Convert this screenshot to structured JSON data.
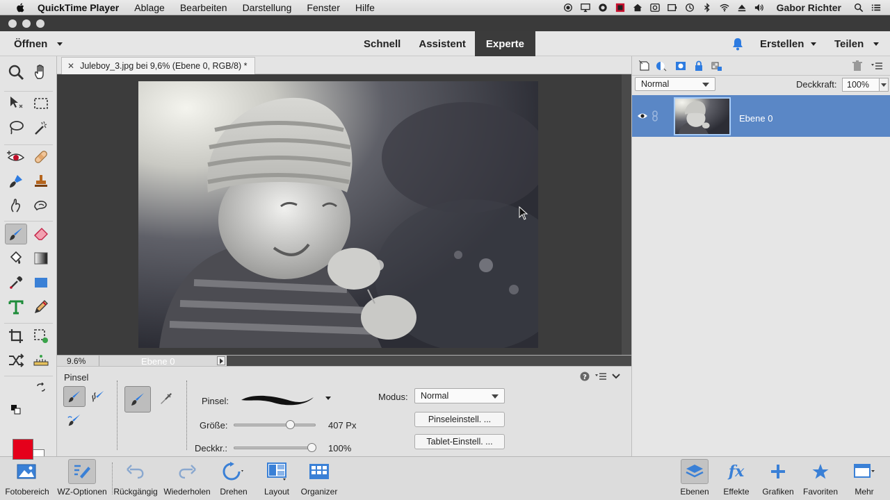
{
  "menubar": {
    "app_name": "QuickTime Player",
    "items": [
      "Ablage",
      "Bearbeiten",
      "Darstellung",
      "Fenster",
      "Hilfe"
    ],
    "user": "Gabor Richter",
    "status_icons": [
      "record-icon",
      "airplay-icon",
      "cc-icon",
      "app-icon",
      "home-icon",
      "network-icon",
      "display-icon",
      "time-machine-icon",
      "bluetooth-icon",
      "wifi-icon",
      "eject-icon",
      "volume-icon"
    ]
  },
  "appbar": {
    "open_label": "Öffnen",
    "modes": [
      {
        "label": "Schnell",
        "active": false
      },
      {
        "label": "Assistent",
        "active": false
      },
      {
        "label": "Experte",
        "active": true
      }
    ],
    "create_label": "Erstellen",
    "share_label": "Teilen"
  },
  "document": {
    "tab_title": "Juleboy_3.jpg bei 9,6% (Ebene 0, RGB/8) *",
    "zoom": "9.6%",
    "layer": "Ebene 0"
  },
  "tool_options": {
    "tool_name": "Pinsel",
    "brush_label": "Pinsel:",
    "size_label": "Größe:",
    "size_value": "407 Px",
    "size_fraction": 0.7,
    "opacity_label": "Deckkr.:",
    "opacity_value": "100%",
    "opacity_fraction": 1.0,
    "mode_label": "Modus:",
    "mode_value": "Normal",
    "brush_settings_label": "Pinseleinstell. ...",
    "tablet_settings_label": "Tablet-Einstell. ..."
  },
  "layers_panel": {
    "blend_mode": "Normal",
    "opacity_label": "Deckkraft:",
    "opacity_value": "100%",
    "layer_name": "Ebene 0"
  },
  "colors": {
    "foreground": "#e5001b",
    "background": "#ffffff",
    "accent": "#5a87c6"
  },
  "taskbar": {
    "left": [
      "Fotobereich",
      "WZ-Optionen",
      "Rückgängig",
      "Wiederholen",
      "Drehen",
      "Layout",
      "Organizer"
    ],
    "right": [
      "Ebenen",
      "Effekte",
      "Grafiken",
      "Favoriten",
      "Mehr"
    ]
  }
}
